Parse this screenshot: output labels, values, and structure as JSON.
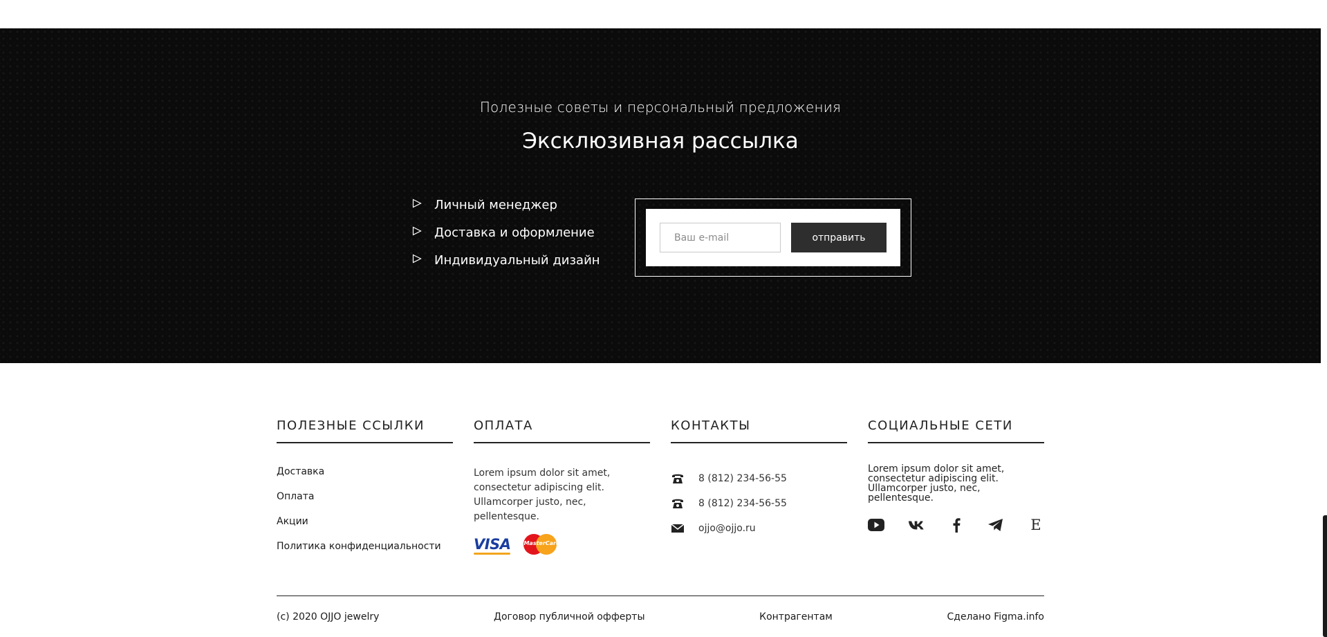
{
  "newsletter": {
    "subtitle": "Полезные советы и персональный предложения",
    "title": "Эксклюзивная рассылка",
    "features": [
      "Личный менеджер",
      "Доставка и оформление",
      "Индивидуальный дизайн"
    ],
    "email_placeholder": "Ваш e-mail",
    "submit_label": "отправить"
  },
  "footer": {
    "links": {
      "heading": "ПОЛЕЗНЫЕ ССЫЛКИ",
      "items": [
        "Доставка",
        "Оплата",
        "Акции",
        "Политика конфиденциальности"
      ]
    },
    "payment": {
      "heading": "ОПЛАТА",
      "text": "Lorem ipsum dolor sit amet, consectetur adipiscing elit. Ullamcorper justo, nec, pellentesque.",
      "visa_label": "VISA",
      "mastercard_label": "MasterCard"
    },
    "contacts": {
      "heading": "КОНТАКТЫ",
      "phone1": "8 (812) 234-56-55",
      "phone2": "8 (812) 234-56-55",
      "email": "ojjo@ojjo.ru"
    },
    "social": {
      "heading": "СОЦИАЛЬНЫЕ СЕТИ",
      "text": "Lorem ipsum dolor sit amet, consectetur adipiscing elit. Ullamcorper justo, nec, pellentesque.",
      "icons": [
        "youtube-icon",
        "vk-icon",
        "facebook-icon",
        "telegram-icon",
        "etsy-icon"
      ],
      "etsy_glyph": "E"
    },
    "bottom": {
      "copyright": "(c) 2020 OJJO jewelry",
      "offer": "Договор публичной офферты",
      "partners": "Контрагентам",
      "made_by": "Сделано Figma.info"
    }
  },
  "colors": {
    "dark_band": "#0b0b0b",
    "button": "#2e2e2e",
    "text": "#1a1a1a"
  }
}
